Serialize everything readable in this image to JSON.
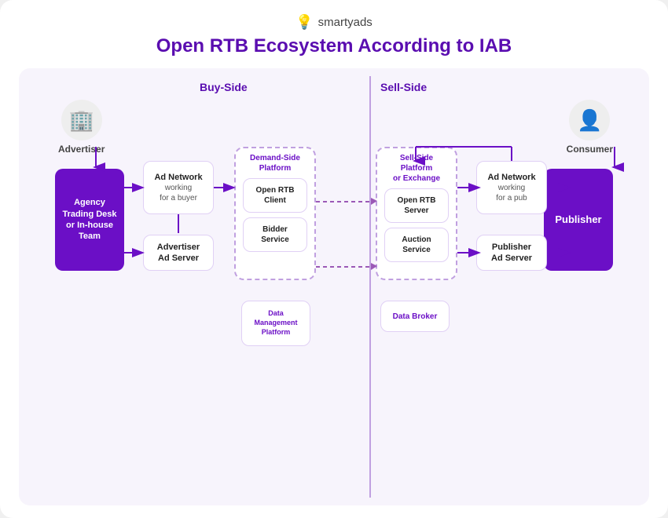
{
  "logo": {
    "icon": "💡",
    "text": "smartyads"
  },
  "title": "Open RTB Ecosystem According to IAB",
  "sections": {
    "buy_side": "Buy-Side",
    "sell_side": "Sell-Side"
  },
  "advertiser": {
    "label": "Advertiser",
    "icon": "🏢"
  },
  "consumer": {
    "label": "Consumer",
    "icon": "👤"
  },
  "agency_box": {
    "text": "Agency\nTrading Desk\nor In-house\nTeam"
  },
  "publisher_box": {
    "text": "Publisher"
  },
  "ad_network_buyer": {
    "title": "Ad Network",
    "sub": "working\nfor a buyer"
  },
  "advertiser_ad_server": {
    "title": "Advertiser\nAd Server"
  },
  "demand_side_platform": {
    "label": "Demand-Side\nPlatform",
    "open_rtb_client": "Open RTB\nClient",
    "bidder_service": "Bidder\nService"
  },
  "sell_side_platform": {
    "label": "Sell-Side\nPlatform\nor Exchange",
    "open_rtb_server": "Open RTB\nServer",
    "auction_service": "Auction\nService"
  },
  "ad_network_pub": {
    "title": "Ad Network",
    "sub": "working\nfor a pub"
  },
  "publisher_ad_server": {
    "title": "Publisher\nAd Server"
  },
  "data_management": {
    "text": "Data\nManagement\nPlatform"
  },
  "data_broker": {
    "text": "Data Broker"
  }
}
